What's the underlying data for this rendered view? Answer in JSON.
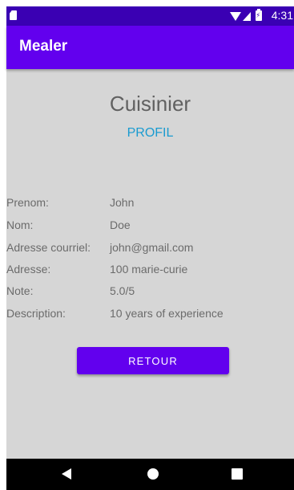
{
  "status_bar": {
    "time": "4:31"
  },
  "app_bar": {
    "title": "Mealer"
  },
  "page": {
    "title": "Cuisinier",
    "subtitle": "PROFIL"
  },
  "profile": {
    "fields": [
      {
        "label": "Prenom:",
        "value": "John"
      },
      {
        "label": "Nom:",
        "value": "Doe"
      },
      {
        "label": "Adresse courriel:",
        "value": "john@gmail.com"
      },
      {
        "label": "Adresse:",
        "value": "100 marie-curie"
      },
      {
        "label": "Note:",
        "value": "5.0/5"
      },
      {
        "label": "Description:",
        "value": "10 years of experience"
      }
    ]
  },
  "actions": {
    "back_label": "RETOUR"
  },
  "colors": {
    "status_bar": "#3a00b3",
    "app_bar": "#6200ee",
    "accent": "#1a9bd0",
    "background": "#d6d6d6"
  },
  "icons": {
    "status": [
      "sd-card-icon",
      "wifi-icon",
      "signal-icon",
      "battery-charging-icon"
    ],
    "nav": [
      "back-icon",
      "home-icon",
      "recent-apps-icon"
    ]
  }
}
